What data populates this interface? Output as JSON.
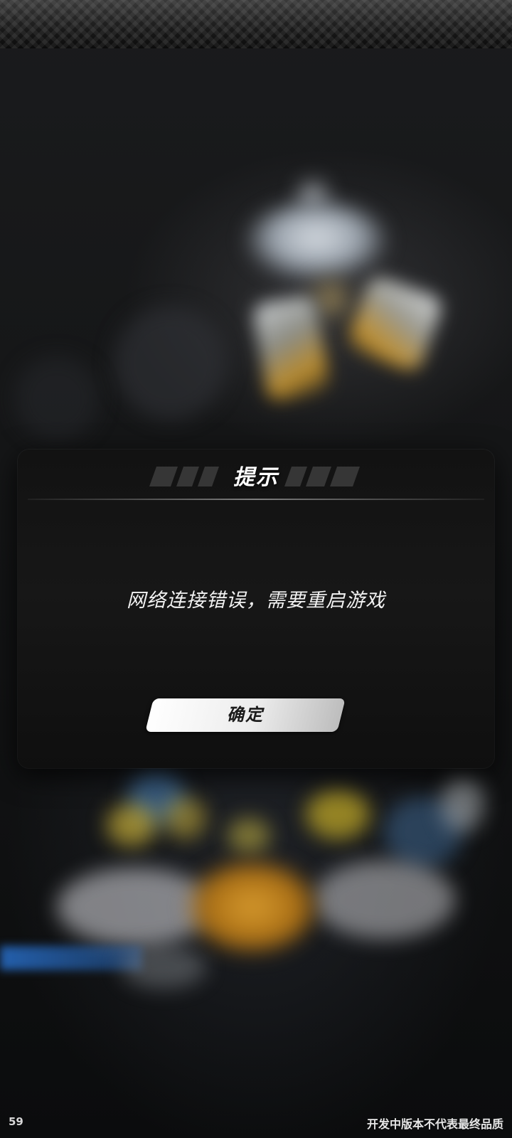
{
  "dialog": {
    "title": "提示",
    "message": "网络连接错误，需要重启游戏",
    "confirm_label": "确定"
  },
  "overlay": {
    "fps": "59",
    "watermark": "开发中版本不代表最终品质"
  }
}
